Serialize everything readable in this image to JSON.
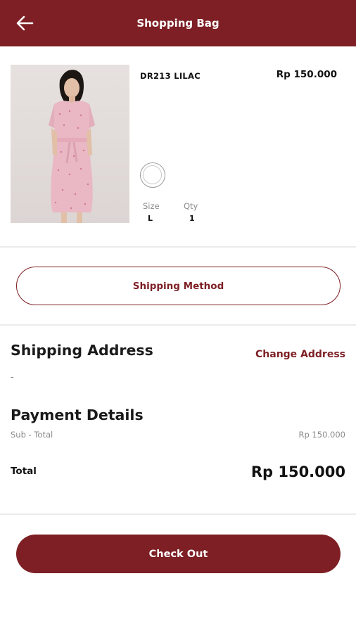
{
  "header": {
    "title": "Shopping Bag",
    "back_icon": "arrow-left-icon"
  },
  "colors": {
    "primary": "#7d1f24",
    "background": "#ffffff",
    "muted_text": "#8a8a8a"
  },
  "cart": {
    "item": {
      "name": "DR213 LILAC",
      "price": "Rp 150.000",
      "color_swatch": "white",
      "size_label": "Size",
      "size_value": "L",
      "qty_label": "Qty",
      "qty_value": "1"
    }
  },
  "shipping_method": {
    "label": "Shipping Method"
  },
  "shipping_address": {
    "title": "Shipping Address",
    "change_label": "Change Address",
    "value": "-"
  },
  "payment": {
    "title": "Payment Details",
    "subtotal_label": "Sub - Total",
    "subtotal_value": "Rp 150.000",
    "total_label": "Total",
    "total_value": "Rp 150.000"
  },
  "checkout": {
    "label": "Check Out"
  }
}
